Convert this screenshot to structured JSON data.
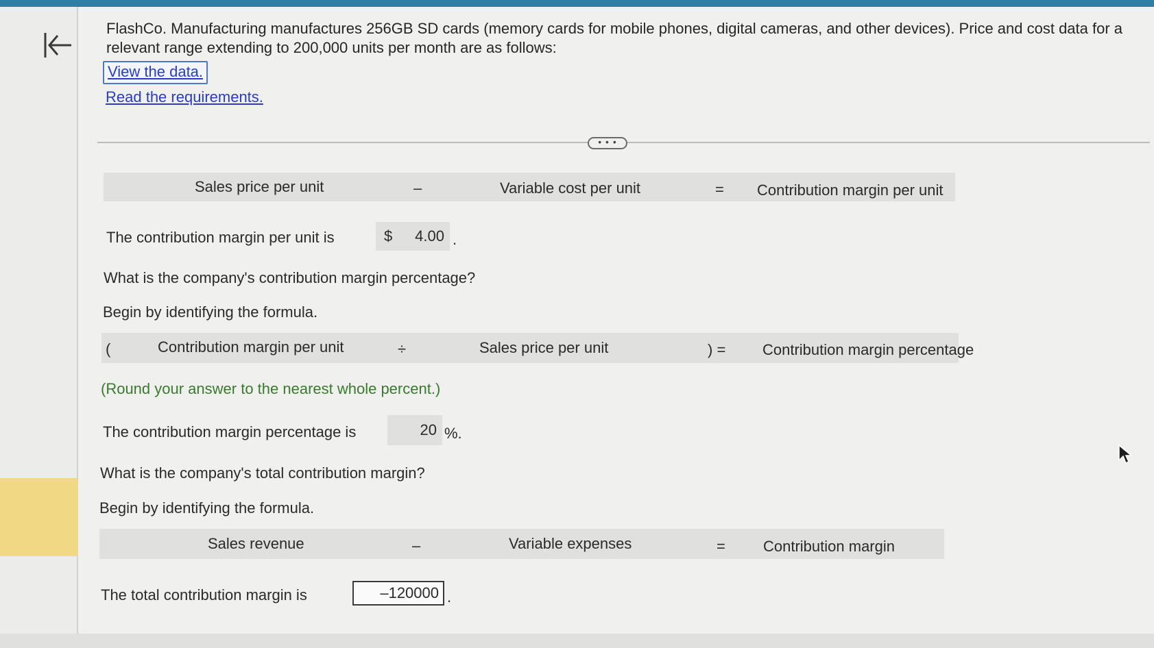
{
  "intro": {
    "text": "FlashCo. Manufacturing manufactures 256GB SD cards (memory cards for mobile phones, digital cameras, and other devices). Price and cost data for a relevant range extending to 200,000 units per month are as follows:"
  },
  "links": {
    "view_data": "View the data.",
    "read_requirements": "Read the requirements."
  },
  "expand_label": "• • •",
  "formula1": {
    "term1": "Sales price per unit",
    "operator": "–",
    "term2": "Variable cost per unit",
    "equals": "=",
    "result": "Contribution margin per unit"
  },
  "answer1": {
    "label": "The contribution margin per unit is",
    "currency": "$",
    "value": "4.00",
    "suffix": "."
  },
  "question2": "What is the company's contribution margin percentage?",
  "begin2": "Begin by identifying the formula.",
  "formula2": {
    "open_paren": "(",
    "term1": "Contribution margin per unit",
    "operator": "÷",
    "term2": "Sales price per unit",
    "close_equals": ") =",
    "result": "Contribution margin percentage"
  },
  "round_note": "(Round your answer to the nearest whole percent.)",
  "answer2": {
    "label": "The contribution margin percentage is",
    "value": "20",
    "suffix": "%."
  },
  "question3": "What is the company's total contribution margin?",
  "begin3": "Begin by identifying the formula.",
  "formula3": {
    "term1": "Sales revenue",
    "operator": "–",
    "term2": "Variable expenses",
    "equals": "=",
    "result": "Contribution margin"
  },
  "answer3": {
    "label": "The total contribution margin is",
    "value": "–120000",
    "suffix": "."
  },
  "colors": {
    "top_bar": "#2f7ea6",
    "link": "#2b3cc4",
    "note": "#3a7a2e",
    "highlight_tab": "#f1d885"
  }
}
